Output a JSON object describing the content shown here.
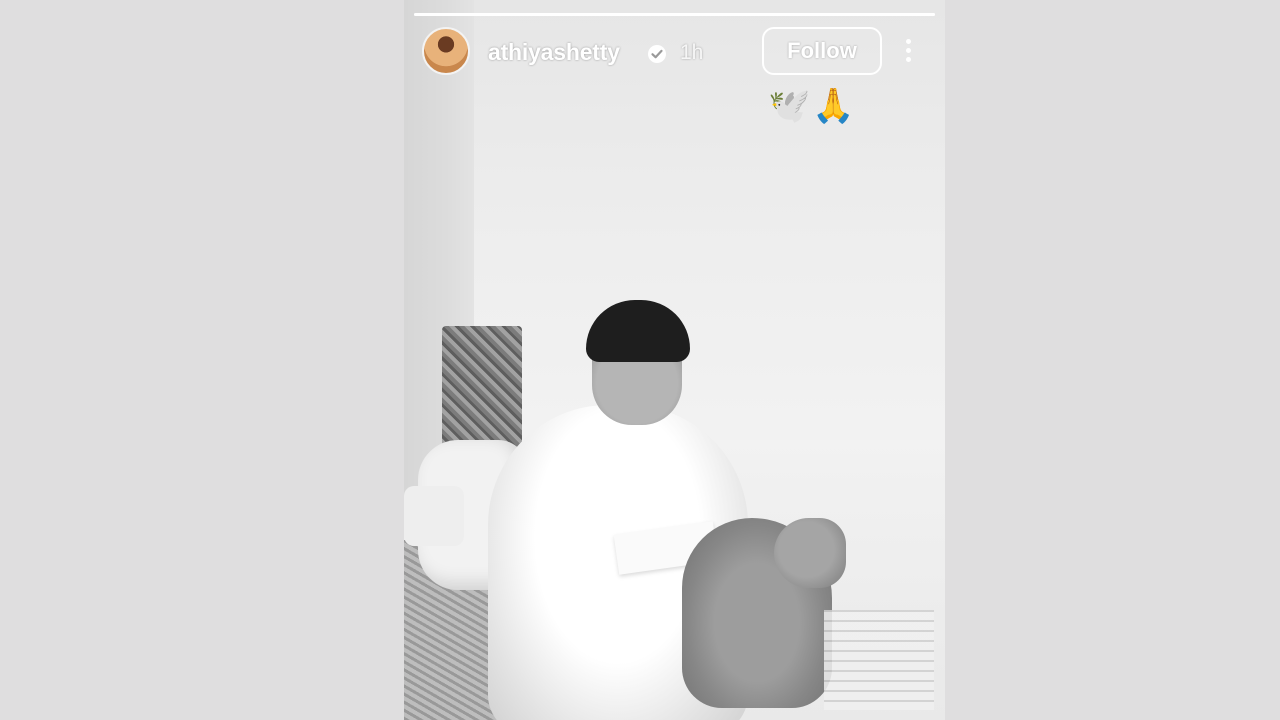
{
  "story": {
    "progress": 1.0,
    "username": "athiyashetty",
    "verified": true,
    "time_ago": "1h",
    "follow_label": "Follow",
    "stickers": "🕊️🙏",
    "colors": {
      "text": "#ffffff",
      "background": "#dfdedf"
    }
  }
}
